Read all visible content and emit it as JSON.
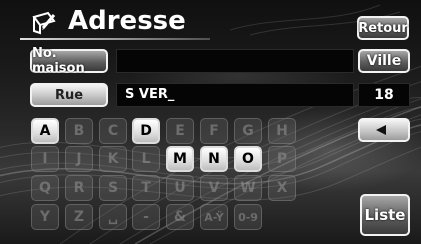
{
  "header": {
    "title": "Adresse",
    "back_label": "Retour",
    "icon": "map-pencil-icon"
  },
  "house_number": {
    "label": "No. maison",
    "value": ""
  },
  "city": {
    "label": "Ville"
  },
  "street": {
    "label": "Rue",
    "value": "S VER_",
    "match_count": "18"
  },
  "backspace_icon": "left-arrow-icon",
  "keyboard": {
    "rows": [
      [
        {
          "char": "A",
          "enabled": true
        },
        {
          "char": "B",
          "enabled": false
        },
        {
          "char": "C",
          "enabled": false
        },
        {
          "char": "D",
          "enabled": true
        },
        {
          "char": "E",
          "enabled": false
        },
        {
          "char": "F",
          "enabled": false
        },
        {
          "char": "G",
          "enabled": false
        },
        {
          "char": "H",
          "enabled": false
        }
      ],
      [
        {
          "char": "I",
          "enabled": false
        },
        {
          "char": "J",
          "enabled": false
        },
        {
          "char": "K",
          "enabled": false
        },
        {
          "char": "L",
          "enabled": false
        },
        {
          "char": "M",
          "enabled": true
        },
        {
          "char": "N",
          "enabled": true
        },
        {
          "char": "O",
          "enabled": true
        },
        {
          "char": "P",
          "enabled": false
        }
      ],
      [
        {
          "char": "Q",
          "enabled": false
        },
        {
          "char": "R",
          "enabled": false
        },
        {
          "char": "S",
          "enabled": false
        },
        {
          "char": "T",
          "enabled": false
        },
        {
          "char": "U",
          "enabled": false
        },
        {
          "char": "V",
          "enabled": false
        },
        {
          "char": "W",
          "enabled": false
        },
        {
          "char": "X",
          "enabled": false
        }
      ],
      [
        {
          "char": "Y",
          "enabled": false
        },
        {
          "char": "Z",
          "enabled": false
        },
        {
          "char": "␣",
          "enabled": false
        },
        {
          "char": "-",
          "enabled": false
        },
        {
          "char": "&",
          "enabled": false
        },
        {
          "char": "A-Ÿ",
          "enabled": false
        },
        {
          "char": "0-9",
          "enabled": false
        }
      ]
    ]
  },
  "list_label": "Liste"
}
